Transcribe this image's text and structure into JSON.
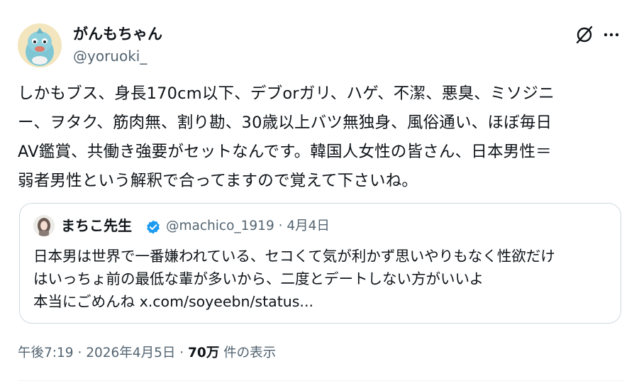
{
  "author": {
    "display_name": "がんもちゃん",
    "handle": "@yoruoki_"
  },
  "header_icons": [
    "grok-icon",
    "more-icon"
  ],
  "tweet_text_lines": [
    "しかもブス、身長170cm以下、デブorガリ、ハゲ、不潔、悪臭、ミソジニ",
    "ー、ヲタク、筋肉無、割り勘、30歳以上バツ無独身、風俗通い、ほぼ毎日",
    "AV鑑賞、共働き強要がセットなんです。韓国人女性の皆さん、日本男性＝",
    "弱者男性という解釈で合ってますので覚えて下さいね。"
  ],
  "quote": {
    "display_name": "まちこ先生",
    "verified": true,
    "handle": "@machico_1919",
    "separator": "·",
    "date": "4月4日",
    "text_lines": [
      "日本男は世界で一番嫌われている、セコくて気が利かず思いやりもなく性欲だけ",
      "はいっちょ前の最低な輩が多いから、二度とデートしない方がいいよ",
      "本当にごめんね x.com/soyeebn/status..."
    ]
  },
  "footer": {
    "time": "午後7:19",
    "sep1": "·",
    "date": "2026年4月5日",
    "sep2": "·",
    "views_count": "70万",
    "views_label": "件の表示"
  },
  "colors": {
    "text": "#0f1419",
    "secondary": "#536471",
    "border": "#cfd9de",
    "verified": "#1d9bf0"
  }
}
